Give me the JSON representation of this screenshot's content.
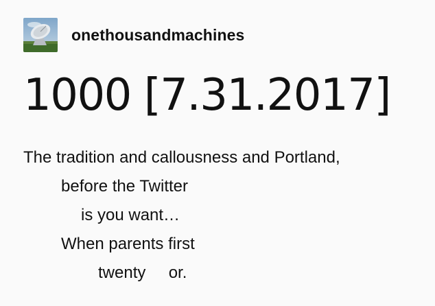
{
  "blog": {
    "avatar_icon": "satellite-dish-avatar",
    "username": "onethousandmachines"
  },
  "post": {
    "title": "1000 [7.31.2017]",
    "lines": [
      "The tradition and callousness and Portland,",
      "before the Twitter",
      "is you want…",
      "When parents first",
      "twenty     or."
    ]
  }
}
